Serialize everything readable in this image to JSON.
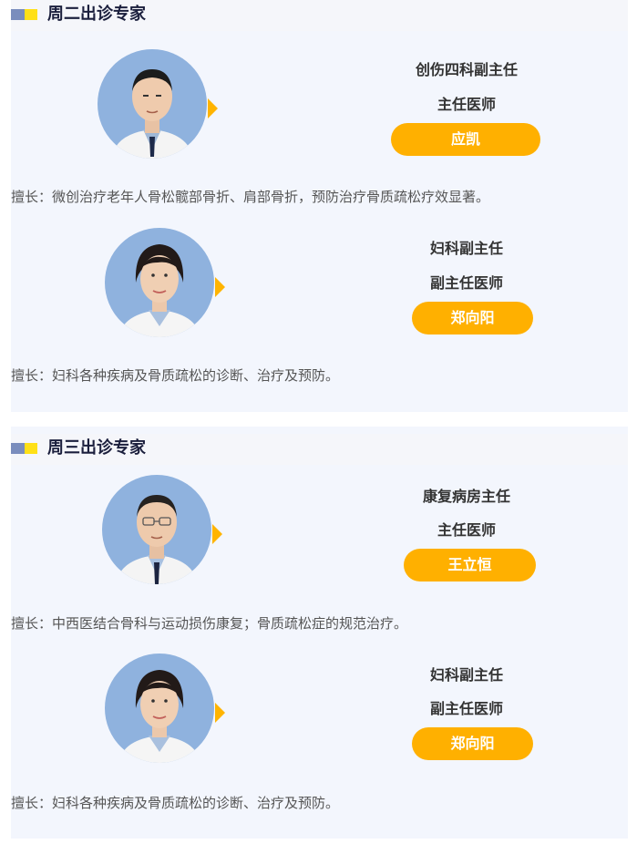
{
  "sections": [
    {
      "title": "周二出诊专家",
      "doctors": [
        {
          "dept": "创伤四科副主任",
          "title": "主任医师",
          "name": "应凯",
          "specialty": "擅长：微创治疗老年人骨松髋部骨折、肩部骨折，预防治疗骨质疏松疗效显著。"
        },
        {
          "dept": "妇科副主任",
          "title": "副主任医师",
          "name": "郑向阳",
          "specialty": "擅长：妇科各种疾病及骨质疏松的诊断、治疗及预防。"
        }
      ]
    },
    {
      "title": "周三出诊专家",
      "doctors": [
        {
          "dept": "康复病房主任",
          "title": "主任医师",
          "name": "王立恒",
          "specialty": "擅长：中西医结合骨科与运动损伤康复；骨质疏松症的规范治疗。"
        },
        {
          "dept": "妇科副主任",
          "title": "副主任医师",
          "name": "郑向阳",
          "specialty": "擅长：妇科各种疾病及骨质疏松的诊断、治疗及预防。"
        }
      ]
    }
  ],
  "colors": {
    "accent": "#ffb000",
    "mark_blue": "#7a8dbd",
    "mark_yellow": "#ffe017",
    "panel": "#f3f6fd",
    "avatar_bg": "#8fb2de"
  },
  "icons": [
    "doctor-portrait",
    "section-marker-icon",
    "pointer-triangle-icon"
  ]
}
